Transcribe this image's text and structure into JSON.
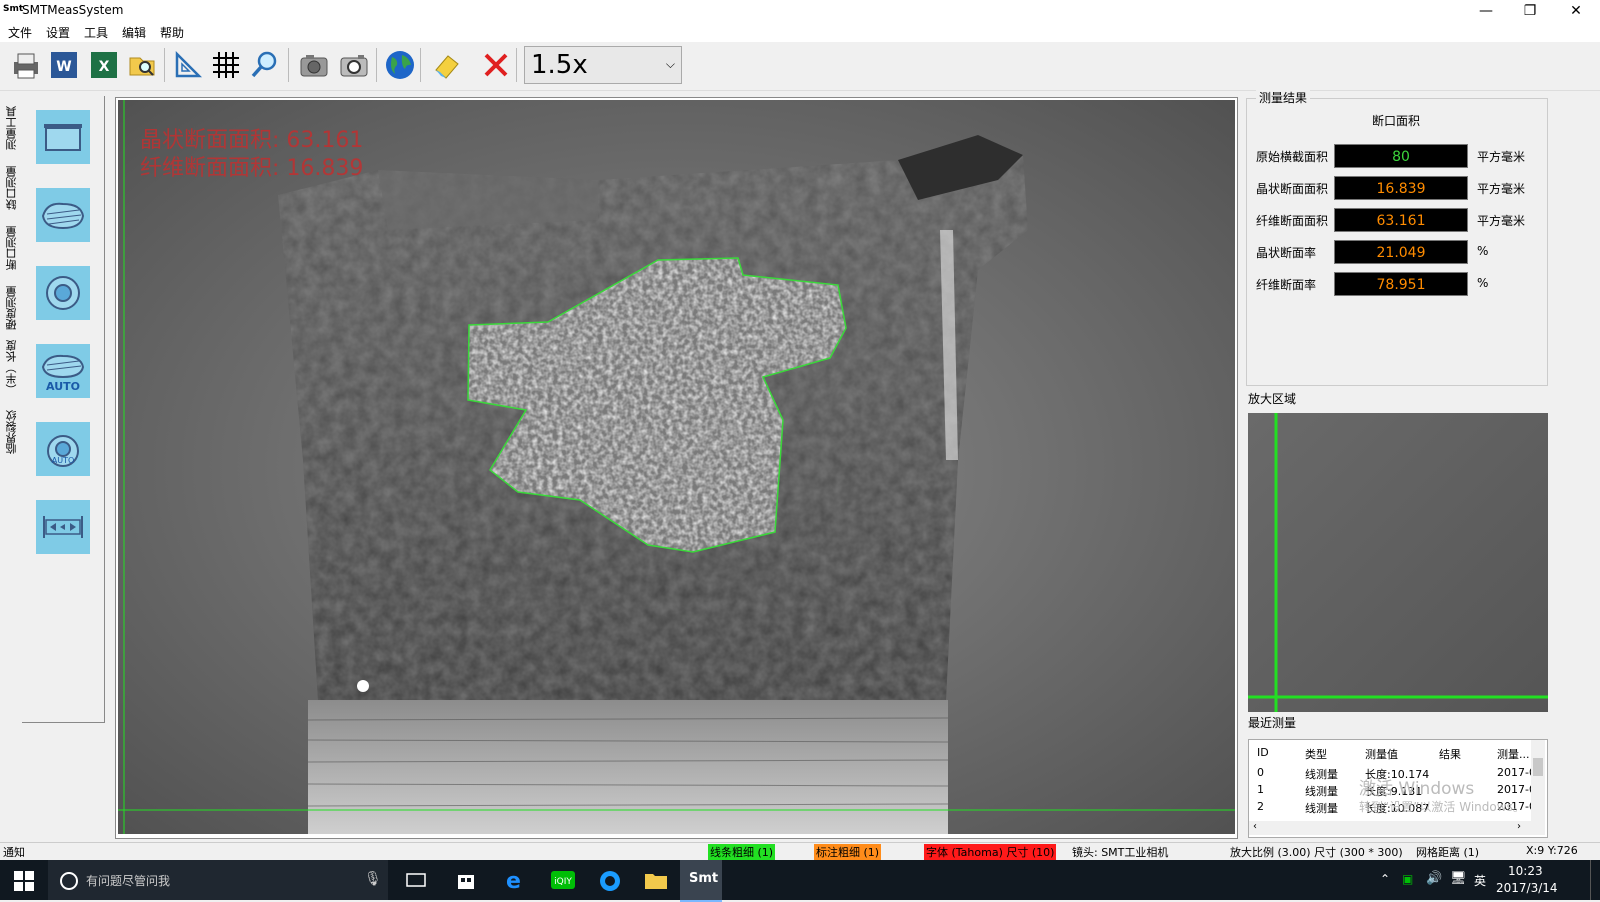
{
  "window": {
    "title": "SMTMeasSystem",
    "logo_text": "Smt",
    "controls": {
      "minimize": "—",
      "restore": "❐",
      "close": "✕"
    }
  },
  "menu": [
    "文件",
    "设置",
    "工具",
    "编辑",
    "帮助"
  ],
  "toolbar": {
    "buttons": [
      "printer-icon",
      "word-icon",
      "excel-icon",
      "folder-search-icon",
      "ruler-triangle-icon",
      "grid-icon",
      "magnifier-icon",
      "camera-icon",
      "camera-snapshot-icon",
      "globe-icon",
      "eraser-icon",
      "delete-icon"
    ],
    "zoom": {
      "value": "1.5x"
    }
  },
  "sidebar": {
    "tabs": [
      "测量工具",
      "缺口测量",
      "断口测量",
      "硬度测量",
      "（半）长度",
      "临界裂纹"
    ],
    "tools": [
      {
        "name": "rect-area-tool-icon",
        "label": ""
      },
      {
        "name": "freeform-area-tool-icon",
        "label": ""
      },
      {
        "name": "circle-tool-icon",
        "label": ""
      },
      {
        "name": "auto-area-tool-icon",
        "label": "AUTO"
      },
      {
        "name": "auto-circle-tool-icon",
        "label": "AUTO"
      },
      {
        "name": "width-measure-tool-icon",
        "label": ""
      }
    ]
  },
  "image_overlay": {
    "line1": "晶状断面面积: 63.161",
    "line2": "纤维断面面积: 16.839"
  },
  "results": {
    "group_title": "测量结果",
    "subtitle": "断口面积",
    "rows": [
      {
        "label": "原始横截面积",
        "value": "80",
        "unit": "平方毫米",
        "color": "#3cd63c"
      },
      {
        "label": "晶状断面面积",
        "value": "16.839",
        "unit": "平方毫米",
        "color": "#ff8c00"
      },
      {
        "label": "纤维断面面积",
        "value": "63.161",
        "unit": "平方毫米",
        "color": "#ff8c00"
      },
      {
        "label": "晶状断面率",
        "value": "21.049",
        "unit": "%",
        "color": "#ff8c00"
      },
      {
        "label": "纤维断面率",
        "value": "78.951",
        "unit": "%",
        "color": "#ff8c00"
      }
    ]
  },
  "zoom_area": {
    "title": "放大区域"
  },
  "recent": {
    "title": "最近测量",
    "columns": [
      "ID",
      "类型",
      "测量值",
      "结果",
      "测量..."
    ],
    "rows": [
      {
        "id": "0",
        "type": "线测量",
        "value": "长度:10.174",
        "result": "",
        "time": "2017-0"
      },
      {
        "id": "1",
        "type": "线测量",
        "value": "长度:9.131",
        "result": "",
        "time": "2017-0"
      },
      {
        "id": "2",
        "type": "线测量",
        "value": "长度:10.087",
        "result": "",
        "time": "2017-0"
      }
    ],
    "watermark1": "激活 Windows",
    "watermark2": "转到“设置”以激活 Windows。"
  },
  "status": {
    "notice": "通知",
    "line_width": "线条粗细 (1)",
    "label_width": "标注粗细 (1)",
    "font": "字体 (Tahoma) 尺寸 (10)",
    "lens": "镜头: SMT工业相机",
    "zoom_info": "放大比例 (3.00) 尺寸 (300 * 300)",
    "grid": "网格距离 (1)",
    "coords": "X:9 Y:726"
  },
  "taskbar": {
    "search_placeholder": "有问题尽管问我",
    "time": "10:23",
    "date": "2017/3/14",
    "ime": "英"
  }
}
